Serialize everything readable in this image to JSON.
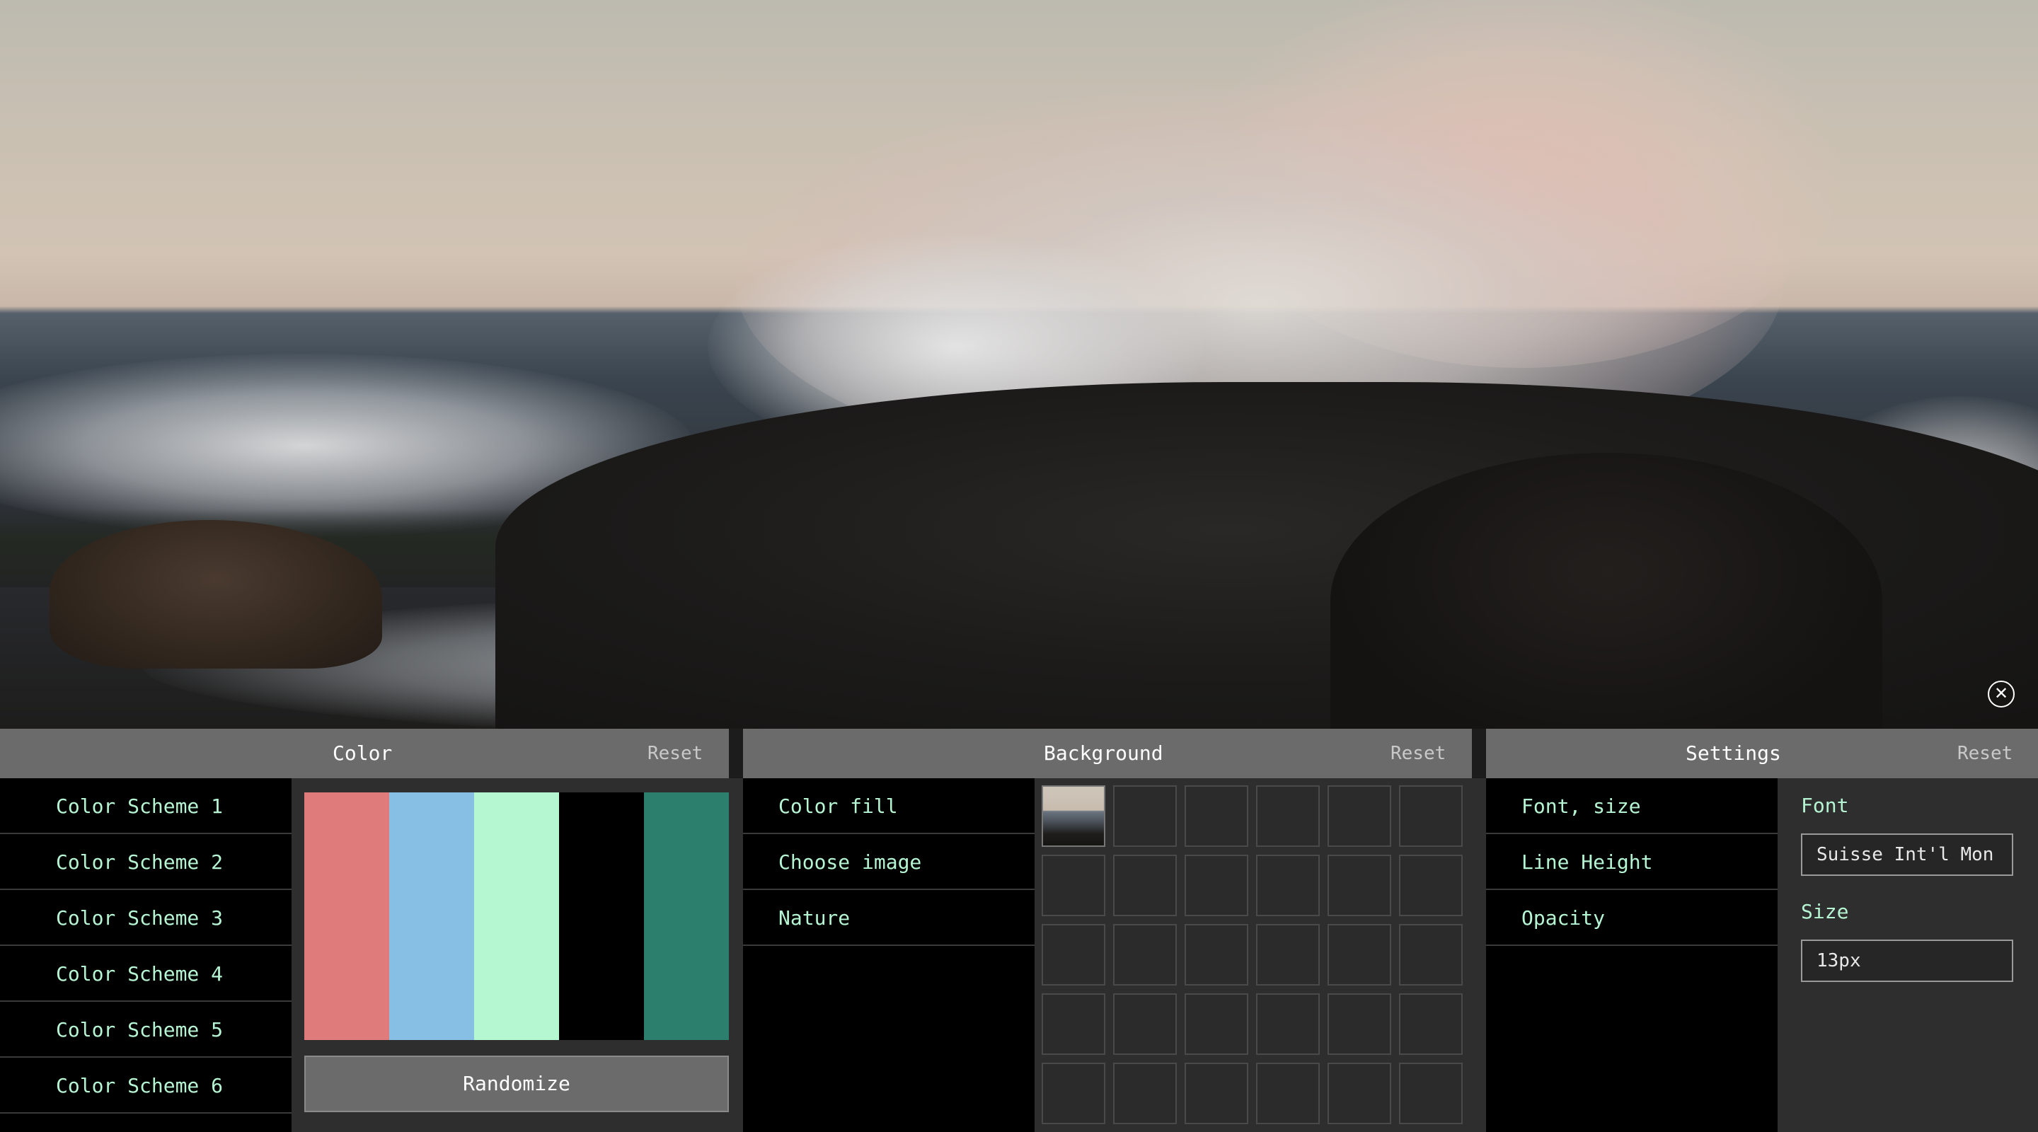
{
  "background_image_description_name": "ocean-waves-rocks-photo",
  "close": {
    "icon": "close-icon"
  },
  "color_panel": {
    "title": "Color",
    "reset": "Reset",
    "schemes": [
      "Color Scheme 1",
      "Color Scheme 2",
      "Color Scheme 3",
      "Color Scheme 4",
      "Color Scheme 5",
      "Color Scheme 6"
    ],
    "swatches": [
      "#e07b7b",
      "#86bfe3",
      "#b5f7d0",
      "#000000",
      "#2c7f6c"
    ],
    "randomize": "Randomize"
  },
  "background_panel": {
    "title": "Background",
    "reset": "Reset",
    "items": [
      "Color fill",
      "Choose image",
      "Nature"
    ],
    "grid_cells": 30
  },
  "settings_panel": {
    "title": "Settings",
    "reset": "Reset",
    "items": [
      "Font, size",
      "Line Height",
      "Opacity"
    ],
    "font_label": "Font",
    "font_value": "Suisse Int'l Mon",
    "size_label": "Size",
    "size_value": "13px"
  },
  "colors": {
    "header_bg": "#6b6b6b",
    "menu_text": "#b6f5d3",
    "panel_bg": "#000000",
    "sub_bg": "#2e2e2e"
  }
}
